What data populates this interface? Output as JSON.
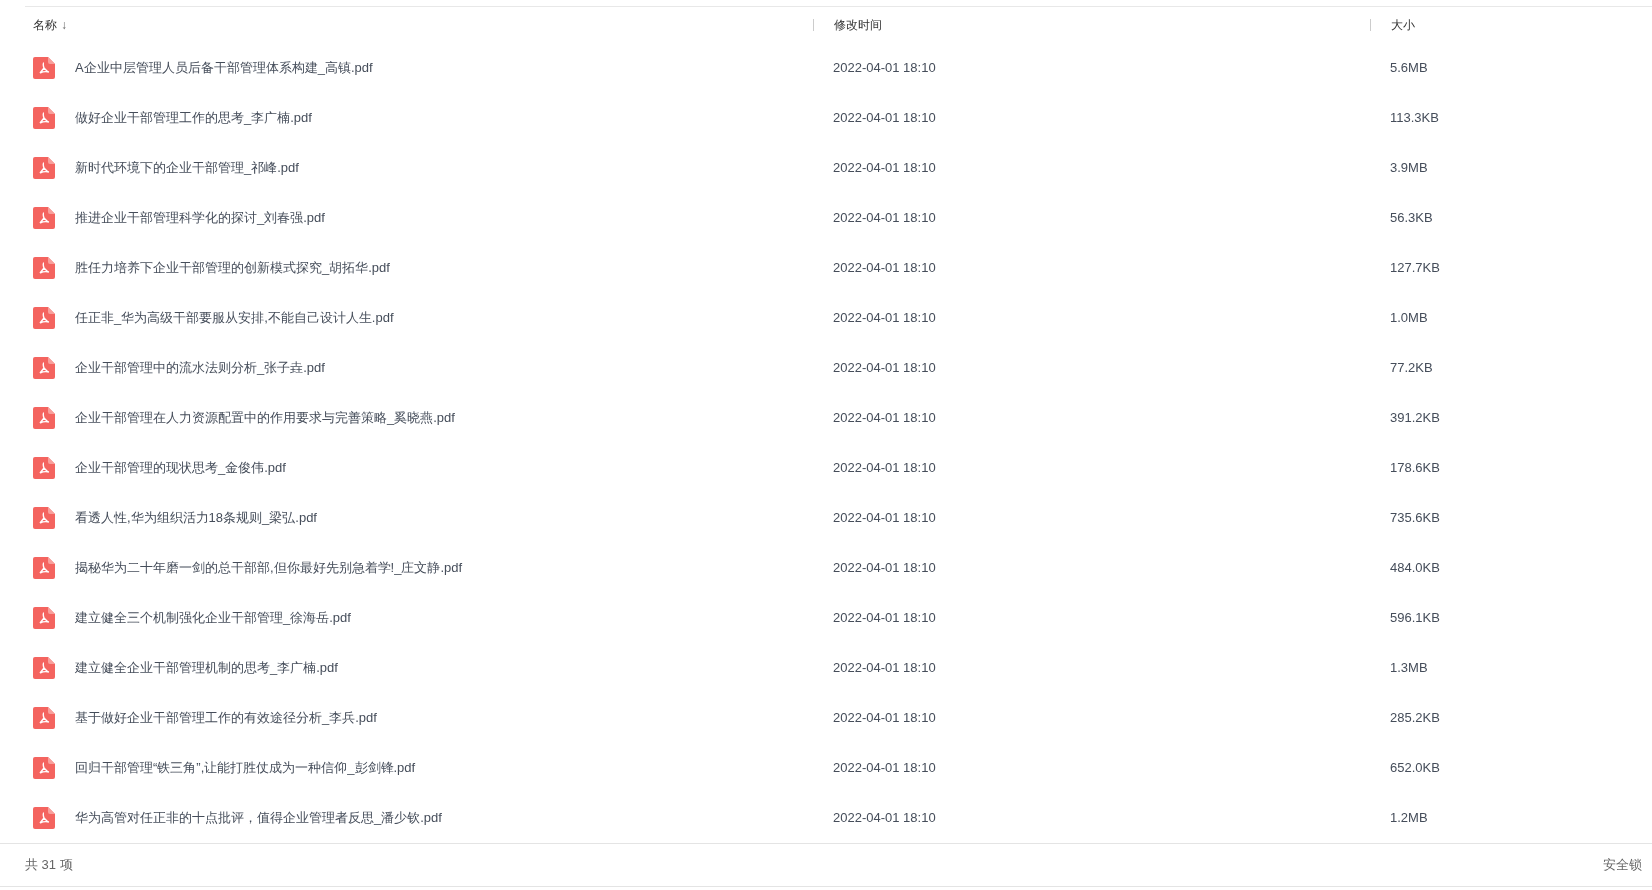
{
  "table": {
    "columns": [
      {
        "label": "名称",
        "sort_icon": "↓"
      },
      {
        "label": "修改时间"
      },
      {
        "label": "大小"
      }
    ],
    "rows": [
      {
        "name": "A企业中层管理人员后备干部管理体系构建_高镇.pdf",
        "modified": "2022-04-01 18:10",
        "size": "5.6MB"
      },
      {
        "name": "做好企业干部管理工作的思考_李广楠.pdf",
        "modified": "2022-04-01 18:10",
        "size": "113.3KB"
      },
      {
        "name": "新时代环境下的企业干部管理_祁峰.pdf",
        "modified": "2022-04-01 18:10",
        "size": "3.9MB"
      },
      {
        "name": "推进企业干部管理科学化的探讨_刘春强.pdf",
        "modified": "2022-04-01 18:10",
        "size": "56.3KB"
      },
      {
        "name": "胜任力培养下企业干部管理的创新模式探究_胡拓华.pdf",
        "modified": "2022-04-01 18:10",
        "size": "127.7KB"
      },
      {
        "name": "任正非_华为高级干部要服从安排,不能自己设计人生.pdf",
        "modified": "2022-04-01 18:10",
        "size": "1.0MB"
      },
      {
        "name": "企业干部管理中的流水法则分析_张子垚.pdf",
        "modified": "2022-04-01 18:10",
        "size": "77.2KB"
      },
      {
        "name": "企业干部管理在人力资源配置中的作用要求与完善策略_奚晓燕.pdf",
        "modified": "2022-04-01 18:10",
        "size": "391.2KB"
      },
      {
        "name": "企业干部管理的现状思考_金俊伟.pdf",
        "modified": "2022-04-01 18:10",
        "size": "178.6KB"
      },
      {
        "name": "看透人性,华为组织活力18条规则_梁弘.pdf",
        "modified": "2022-04-01 18:10",
        "size": "735.6KB"
      },
      {
        "name": "揭秘华为二十年磨一剑的总干部部,但你最好先别急着学!_庄文静.pdf",
        "modified": "2022-04-01 18:10",
        "size": "484.0KB"
      },
      {
        "name": "建立健全三个机制强化企业干部管理_徐海岳.pdf",
        "modified": "2022-04-01 18:10",
        "size": "596.1KB"
      },
      {
        "name": "建立健全企业干部管理机制的思考_李广楠.pdf",
        "modified": "2022-04-01 18:10",
        "size": "1.3MB"
      },
      {
        "name": "基于做好企业干部管理工作的有效途径分析_李兵.pdf",
        "modified": "2022-04-01 18:10",
        "size": "285.2KB"
      },
      {
        "name": "回归干部管理“铁三角”,让能打胜仗成为一种信仰_彭剑锋.pdf",
        "modified": "2022-04-01 18:10",
        "size": "652.0KB"
      },
      {
        "name": "华为高管对任正非的十点批评，值得企业管理者反思_潘少钦.pdf",
        "modified": "2022-04-01 18:10",
        "size": "1.2MB"
      }
    ]
  },
  "footer": {
    "count": "共 31 项",
    "lock": "安全锁"
  }
}
